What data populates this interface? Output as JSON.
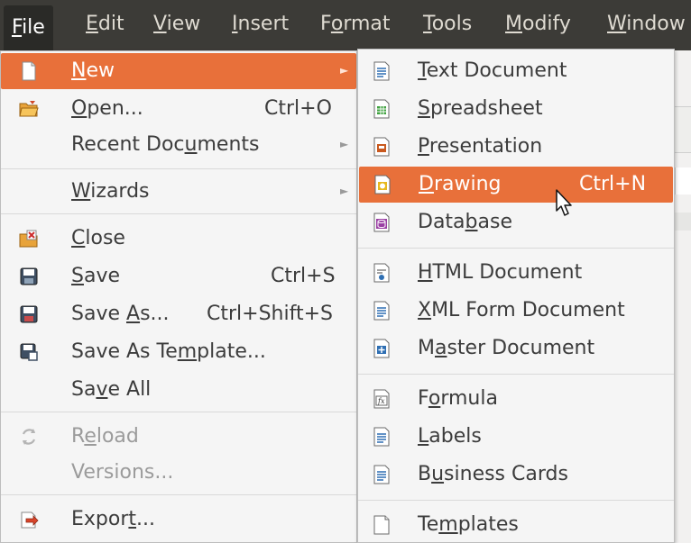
{
  "menubar": {
    "items": [
      {
        "label": "File",
        "pre": "",
        "u": "F",
        "post": "ile"
      },
      {
        "label": "Edit",
        "pre": "",
        "u": "E",
        "post": "dit"
      },
      {
        "label": "View",
        "pre": "",
        "u": "V",
        "post": "iew"
      },
      {
        "label": "Insert",
        "pre": "",
        "u": "I",
        "post": "nsert"
      },
      {
        "label": "Format",
        "pre": "F",
        "u": "o",
        "post": "rmat"
      },
      {
        "label": "Tools",
        "pre": "",
        "u": "T",
        "post": "ools"
      },
      {
        "label": "Modify",
        "pre": "",
        "u": "M",
        "post": "odify"
      },
      {
        "label": "Window",
        "pre": "",
        "u": "W",
        "post": "indow"
      }
    ]
  },
  "file_menu": {
    "items": [
      {
        "pre": "",
        "u": "N",
        "post": "ew",
        "shortcut": "",
        "icon": "new-document-icon"
      },
      {
        "pre": "",
        "u": "O",
        "post": "pen...",
        "shortcut": "Ctrl+O",
        "icon": "open-folder-icon"
      },
      {
        "pre": "Recent Doc",
        "u": "u",
        "post": "ments",
        "shortcut": "",
        "icon": ""
      },
      {
        "pre": "",
        "u": "W",
        "post": "izards",
        "shortcut": "",
        "icon": ""
      },
      {
        "pre": "",
        "u": "C",
        "post": "lose",
        "shortcut": "",
        "icon": "close-document-icon"
      },
      {
        "pre": "",
        "u": "S",
        "post": "ave",
        "shortcut": "Ctrl+S",
        "icon": "save-icon"
      },
      {
        "pre": "Save ",
        "u": "A",
        "post": "s...",
        "shortcut": "Ctrl+Shift+S",
        "icon": "save-as-icon"
      },
      {
        "pre": "Save As Te",
        "u": "m",
        "post": "plate...",
        "shortcut": "",
        "icon": "save-as-template-icon"
      },
      {
        "pre": "Sa",
        "u": "v",
        "post": "e All",
        "shortcut": "",
        "icon": ""
      },
      {
        "pre": "R",
        "u": "e",
        "post": "load",
        "shortcut": "",
        "icon": "reload-icon"
      },
      {
        "pre": "Versions...",
        "u": "",
        "post": "",
        "shortcut": "",
        "icon": ""
      },
      {
        "pre": "Expor",
        "u": "t",
        "post": "...",
        "shortcut": "",
        "icon": "export-icon"
      }
    ]
  },
  "new_menu": {
    "items": [
      {
        "pre": "",
        "u": "T",
        "post": "ext Document",
        "shortcut": "",
        "icon": "text-document-icon"
      },
      {
        "pre": "",
        "u": "S",
        "post": "preadsheet",
        "shortcut": "",
        "icon": "spreadsheet-icon"
      },
      {
        "pre": "",
        "u": "P",
        "post": "resentation",
        "shortcut": "",
        "icon": "presentation-icon"
      },
      {
        "pre": "",
        "u": "D",
        "post": "rawing",
        "shortcut": "Ctrl+N",
        "icon": "drawing-icon"
      },
      {
        "pre": "Data",
        "u": "b",
        "post": "ase",
        "shortcut": "",
        "icon": "database-icon"
      },
      {
        "pre": "",
        "u": "H",
        "post": "TML Document",
        "shortcut": "",
        "icon": "html-document-icon"
      },
      {
        "pre": "",
        "u": "X",
        "post": "ML Form Document",
        "shortcut": "",
        "icon": "xml-form-document-icon"
      },
      {
        "pre": "M",
        "u": "a",
        "post": "ster Document",
        "shortcut": "",
        "icon": "master-document-icon"
      },
      {
        "pre": "F",
        "u": "o",
        "post": "rmula",
        "shortcut": "",
        "icon": "formula-icon"
      },
      {
        "pre": "",
        "u": "L",
        "post": "abels",
        "shortcut": "",
        "icon": "labels-icon"
      },
      {
        "pre": "B",
        "u": "u",
        "post": "siness Cards",
        "shortcut": "",
        "icon": "business-cards-icon"
      },
      {
        "pre": "Te",
        "u": "m",
        "post": "plates",
        "shortcut": "",
        "icon": "templates-icon"
      }
    ]
  },
  "colors": {
    "menubar_bg": "#3c3b37",
    "highlight": "#e8703a",
    "menu_bg": "#f5f5f5",
    "disabled_text": "#9b9b9b"
  }
}
